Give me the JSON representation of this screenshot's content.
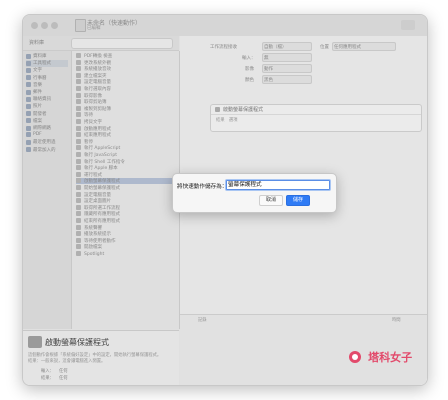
{
  "window": {
    "title": "未命名（快速動作）",
    "subtitle": "已編輯"
  },
  "library": {
    "header_label": "資料庫",
    "categories": [
      {
        "label": "資料庫"
      },
      {
        "label": "工具程式"
      },
      {
        "label": "文字"
      },
      {
        "label": "行事曆"
      },
      {
        "label": "音樂"
      },
      {
        "label": "郵件"
      },
      {
        "label": "聯絡資訊"
      },
      {
        "label": "照片"
      },
      {
        "label": "開發者"
      },
      {
        "label": "檔案"
      },
      {
        "label": "網際網路"
      },
      {
        "label": "PDF"
      },
      {
        "label": "最近使用過"
      },
      {
        "label": "最常加入的"
      }
    ],
    "actions": [
      {
        "label": "PDF轉換 檢查"
      },
      {
        "label": "更改系統外觀"
      },
      {
        "label": "系統播放音效"
      },
      {
        "label": "建立檔案夾"
      },
      {
        "label": "設定電腦音量"
      },
      {
        "label": "執行選取內容"
      },
      {
        "label": "取得影像"
      },
      {
        "label": "取得剪貼簿"
      },
      {
        "label": "複製到剪貼簿"
      },
      {
        "label": "等待"
      },
      {
        "label": "拷貝文字"
      },
      {
        "label": "啟動應用程式"
      },
      {
        "label": "結束應用程式"
      },
      {
        "label": "暫停"
      },
      {
        "label": "執行 AppleScript"
      },
      {
        "label": "執行 JavaScript"
      },
      {
        "label": "執行 Shell 工作指令"
      },
      {
        "label": "執行 Apple 腳本"
      },
      {
        "label": "運行程式"
      },
      {
        "label": "啟動螢幕保護程式"
      },
      {
        "label": "開始螢幕保護程式"
      },
      {
        "label": "設定電腦音量"
      },
      {
        "label": "設定桌面圖片"
      },
      {
        "label": "取得所選工作流程"
      },
      {
        "label": "隱藏所有應用程式"
      },
      {
        "label": "結束所有應用程式"
      },
      {
        "label": "系統聲響"
      },
      {
        "label": "播放系統提示"
      },
      {
        "label": "等待使用者動作"
      },
      {
        "label": "開啟檔案"
      },
      {
        "label": "Spotlight"
      }
    ],
    "selected_action": "啟動螢幕保護程式"
  },
  "description": {
    "title": "啟動螢幕保護程式",
    "lines": [
      "這個動作會根據「系統偏好設定」中的設定，開始執行螢幕保護程式。",
      "結果：一般來說，這會讓電腦進入閒置。"
    ],
    "input_label": "輸入：",
    "input_value": "任何",
    "result_label": "結果：",
    "result_value": "任何"
  },
  "workflow": {
    "receives_label": "工作流程接收",
    "receives_value": "自動（檔）",
    "in_label": "位置",
    "in_value": "任何應用程式",
    "input_label": "輸入：",
    "input_value": "無",
    "image_label": "影像",
    "image_value": "動作",
    "color_label": "顏色",
    "color_value": "黑色",
    "card_title": "啟動螢幕保護程式",
    "card_options": "結果　選項",
    "log_col1": "記錄",
    "log_col2": "時間"
  },
  "dialog": {
    "label": "將快速動作儲存為：",
    "value": "螢幕保護程式",
    "cancel": "取消",
    "save": "儲存"
  },
  "watermark": {
    "text": "塔科女子"
  }
}
